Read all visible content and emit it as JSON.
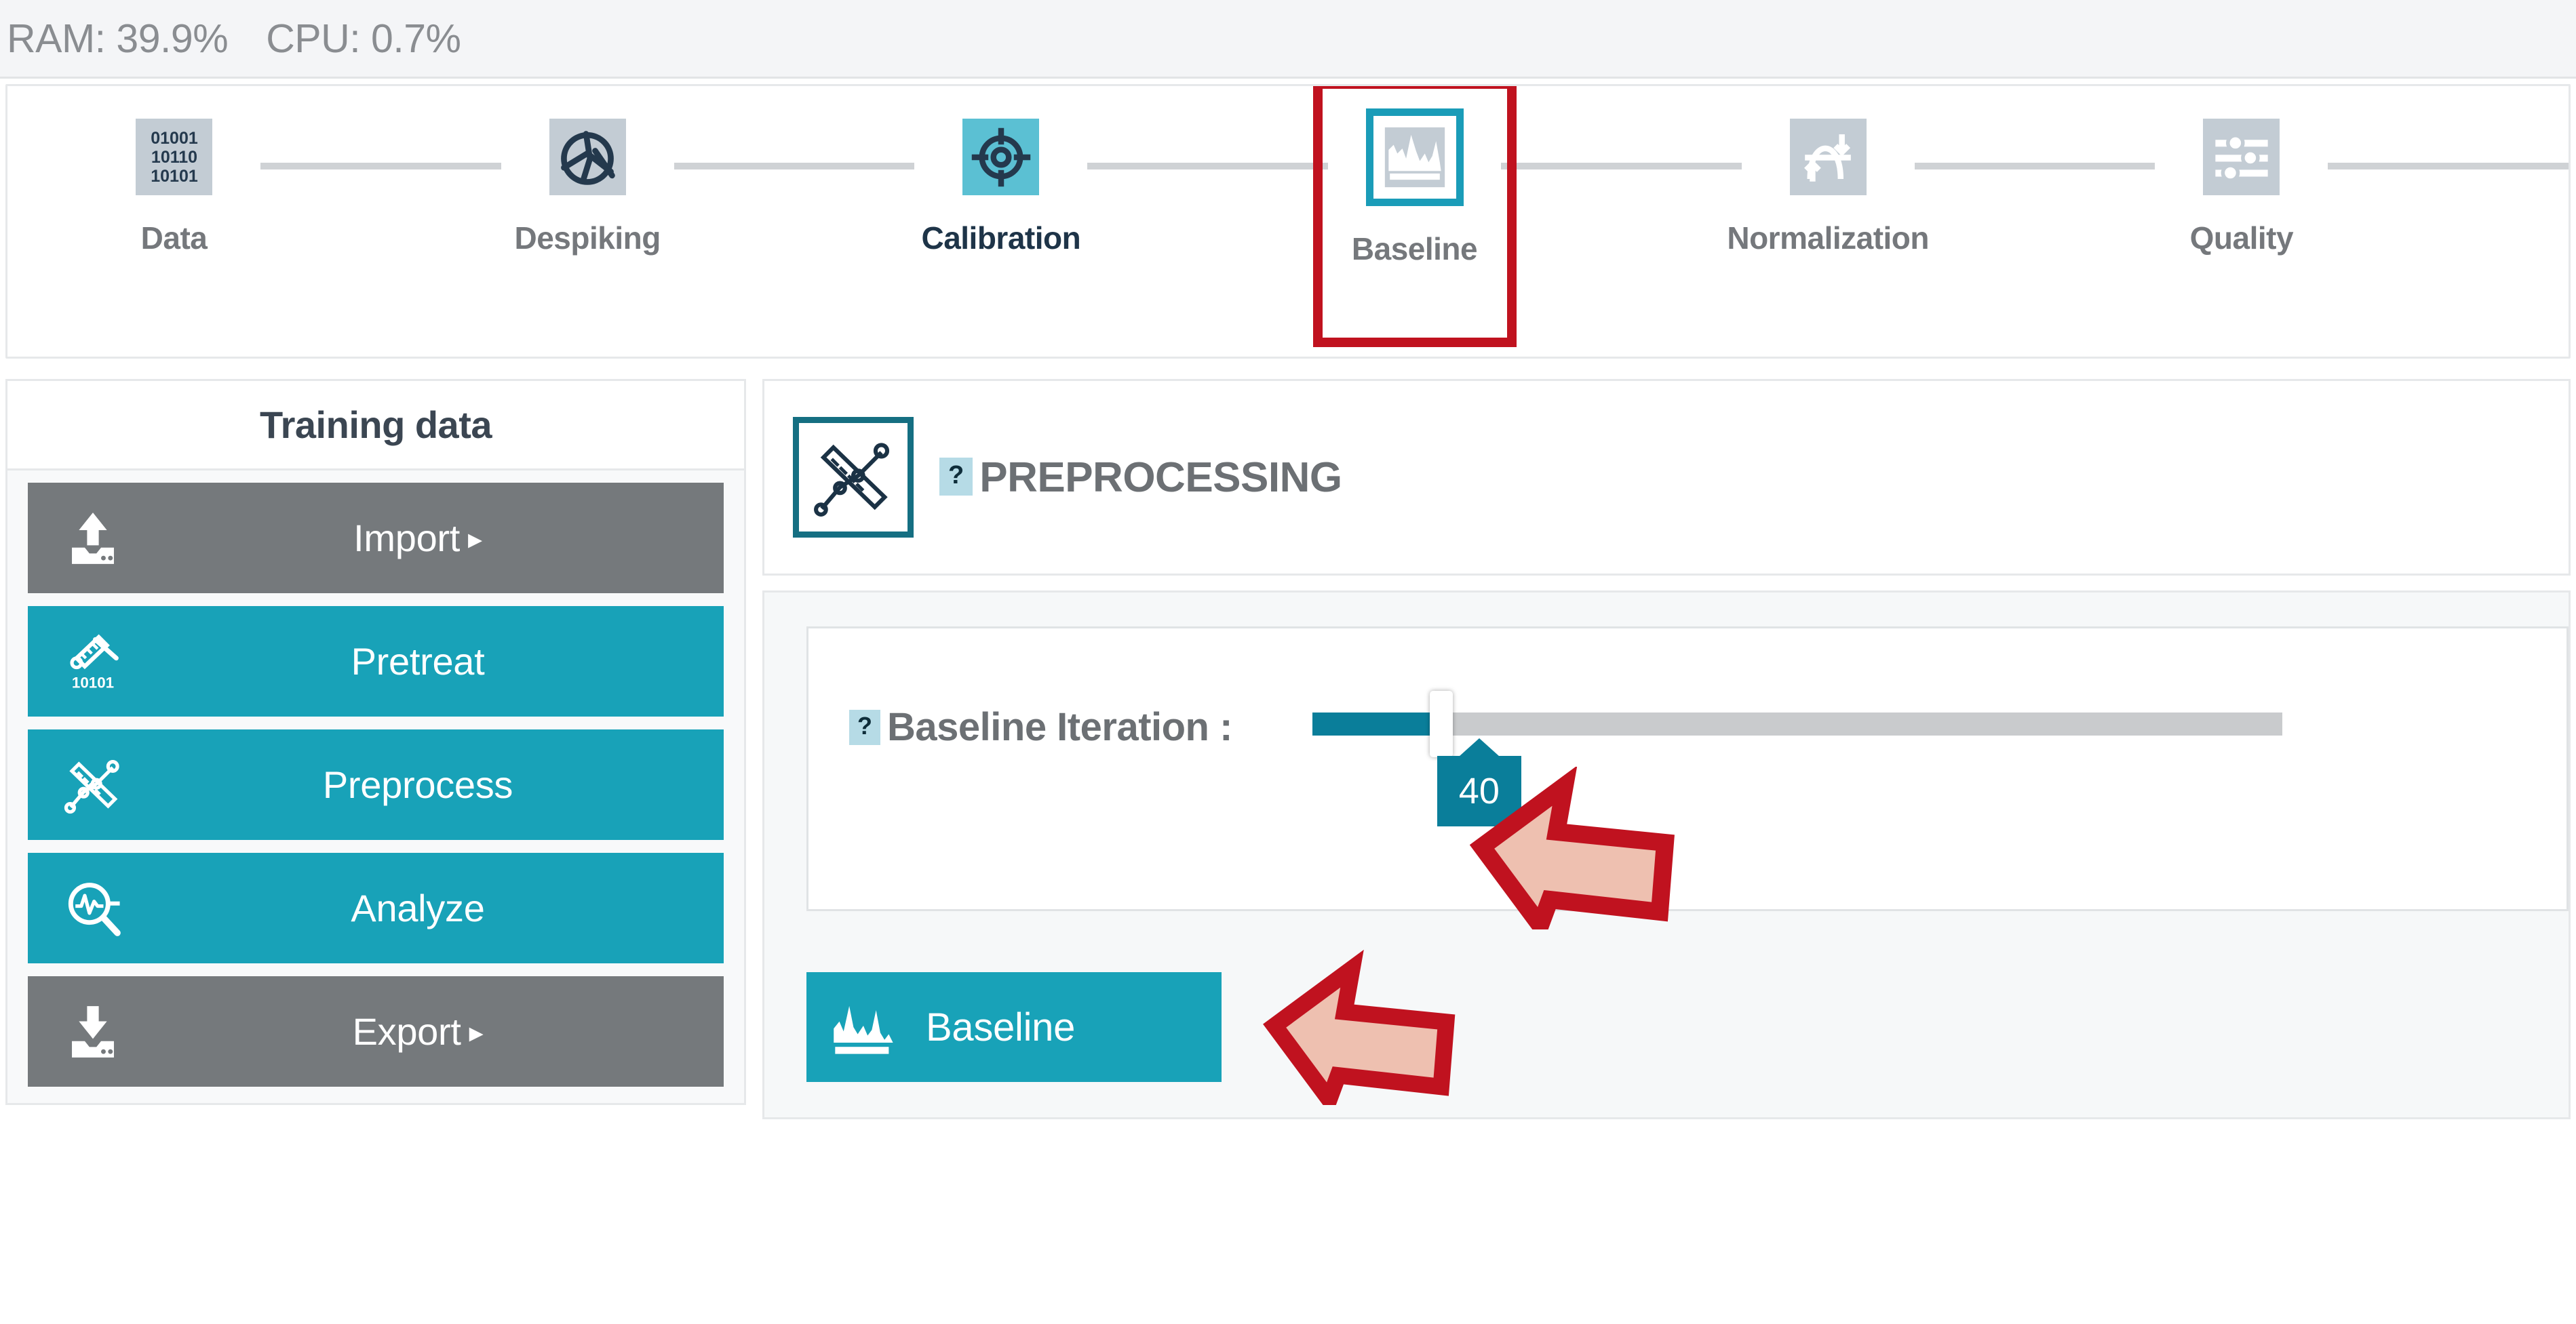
{
  "statusbar": {
    "ram": "RAM: 39.9%",
    "cpu": "CPU: 0.7%"
  },
  "stepper": {
    "steps": [
      {
        "label": "Data",
        "icon": "binary-data-icon",
        "state": "inactive"
      },
      {
        "label": "Despiking",
        "icon": "despike-icon",
        "state": "inactive"
      },
      {
        "label": "Calibration",
        "icon": "crosshair-icon",
        "state": "done"
      },
      {
        "label": "Baseline",
        "icon": "baseline-spectrum-icon",
        "state": "selected"
      },
      {
        "label": "Normalization",
        "icon": "normalization-icon",
        "state": "inactive"
      },
      {
        "label": "Quality",
        "icon": "sliders-icon",
        "state": "inactive"
      }
    ],
    "binary_rows": [
      "01001",
      "10110",
      "10101"
    ]
  },
  "sidebar": {
    "title": "Training data",
    "items": [
      {
        "label": "Import",
        "caret": "▸",
        "icon": "upload-icon",
        "style": "gray"
      },
      {
        "label": "Pretreat",
        "caret": "",
        "icon": "pretreat-icon",
        "style": "teal"
      },
      {
        "label": "Preprocess",
        "caret": "",
        "icon": "preprocess-icon",
        "style": "teal"
      },
      {
        "label": "Analyze",
        "caret": "",
        "icon": "analyze-icon",
        "style": "teal"
      },
      {
        "label": "Export",
        "caret": "▸",
        "icon": "download-icon",
        "style": "gray"
      }
    ]
  },
  "main": {
    "header": {
      "help": "?",
      "title": "PREPROCESSING",
      "icon": "preprocess-icon"
    },
    "parameter": {
      "help": "?",
      "label": "Baseline Iteration :",
      "value": "40",
      "min": 0,
      "max": 100,
      "fill_percent": 13.3
    },
    "action": {
      "label": "Baseline",
      "icon": "baseline-spectrum-icon"
    }
  },
  "annotations": {
    "arrow_color_fill": "#eec0b0",
    "arrow_color_stroke": "#c0121f",
    "highlight_color": "#c0121f"
  },
  "colors": {
    "teal": "#18a2b8",
    "teal_dark": "#0a7e9a",
    "teal_light": "#5bc0d3",
    "gray_btn": "#75797c",
    "navy": "#1e3448",
    "icon_gray_bg": "#c3ccd4"
  }
}
